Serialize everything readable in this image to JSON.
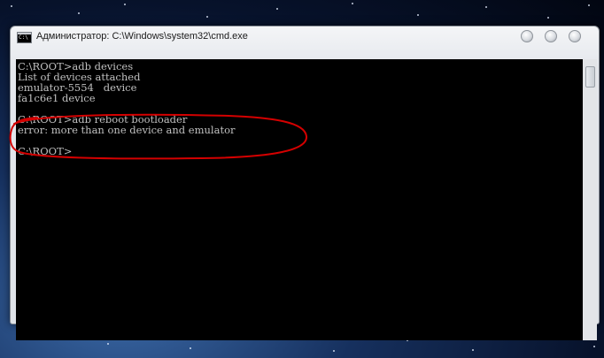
{
  "window": {
    "title": "Администратор: C:\\Windows\\system32\\cmd.exe",
    "icon": "cmd-icon",
    "icon_text": "C:\\"
  },
  "controls": {
    "minimize": "minimize-button",
    "maximize": "maximize-button",
    "close": "close-button"
  },
  "console": {
    "lines": [
      "C:\\ROOT>adb devices",
      "List of devices attached",
      "emulator-5554   device",
      "fa1c6e1 device",
      "",
      "C:\\ROOT>adb reboot bootloader",
      "error: more than one device and emulator",
      "",
      "C:\\ROOT>"
    ],
    "text_color": "#c0c0c0",
    "background": "#000000"
  },
  "annotation": {
    "color": "#d40000",
    "marks": "lines 6-7"
  }
}
